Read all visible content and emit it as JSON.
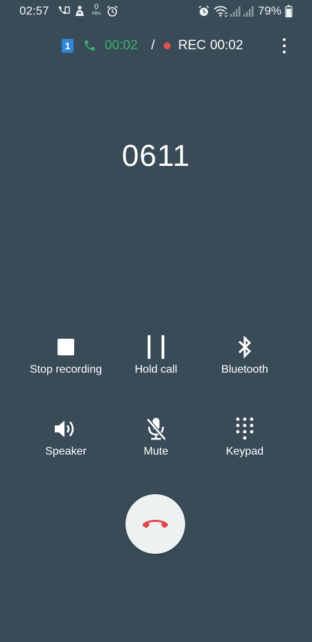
{
  "status_bar": {
    "time": "02:57",
    "net_speed_value": "0",
    "net_speed_unit": "KB/s",
    "battery_percent": "79%"
  },
  "call_info": {
    "sim_slot": "1",
    "call_duration": "00:02",
    "separator": "/",
    "rec_label": "REC",
    "rec_duration": "00:02"
  },
  "caller": {
    "number": "0611"
  },
  "controls": {
    "stop_recording": "Stop recording",
    "hold_call": "Hold call",
    "bluetooth": "Bluetooth",
    "speaker": "Speaker",
    "mute": "Mute",
    "keypad": "Keypad"
  },
  "colors": {
    "background": "#394b57",
    "call_timer": "#37b46a",
    "rec_dot": "#e4524c",
    "end_call_icon": "#e2474a",
    "sim_badge": "#2e86d6"
  },
  "icons": {
    "status": [
      "volte-icon",
      "data-usage-icon",
      "alarm-icon",
      "alarm-icon",
      "wifi-icon",
      "signal-icon",
      "signal-icon",
      "battery-icon"
    ],
    "call": [
      "sim-icon",
      "phone-icon",
      "more-vert-icon"
    ],
    "controls": [
      "stop-icon",
      "pause-icon",
      "bluetooth-icon",
      "speaker-icon",
      "mic-off-icon",
      "dialpad-icon",
      "call-end-icon"
    ]
  }
}
